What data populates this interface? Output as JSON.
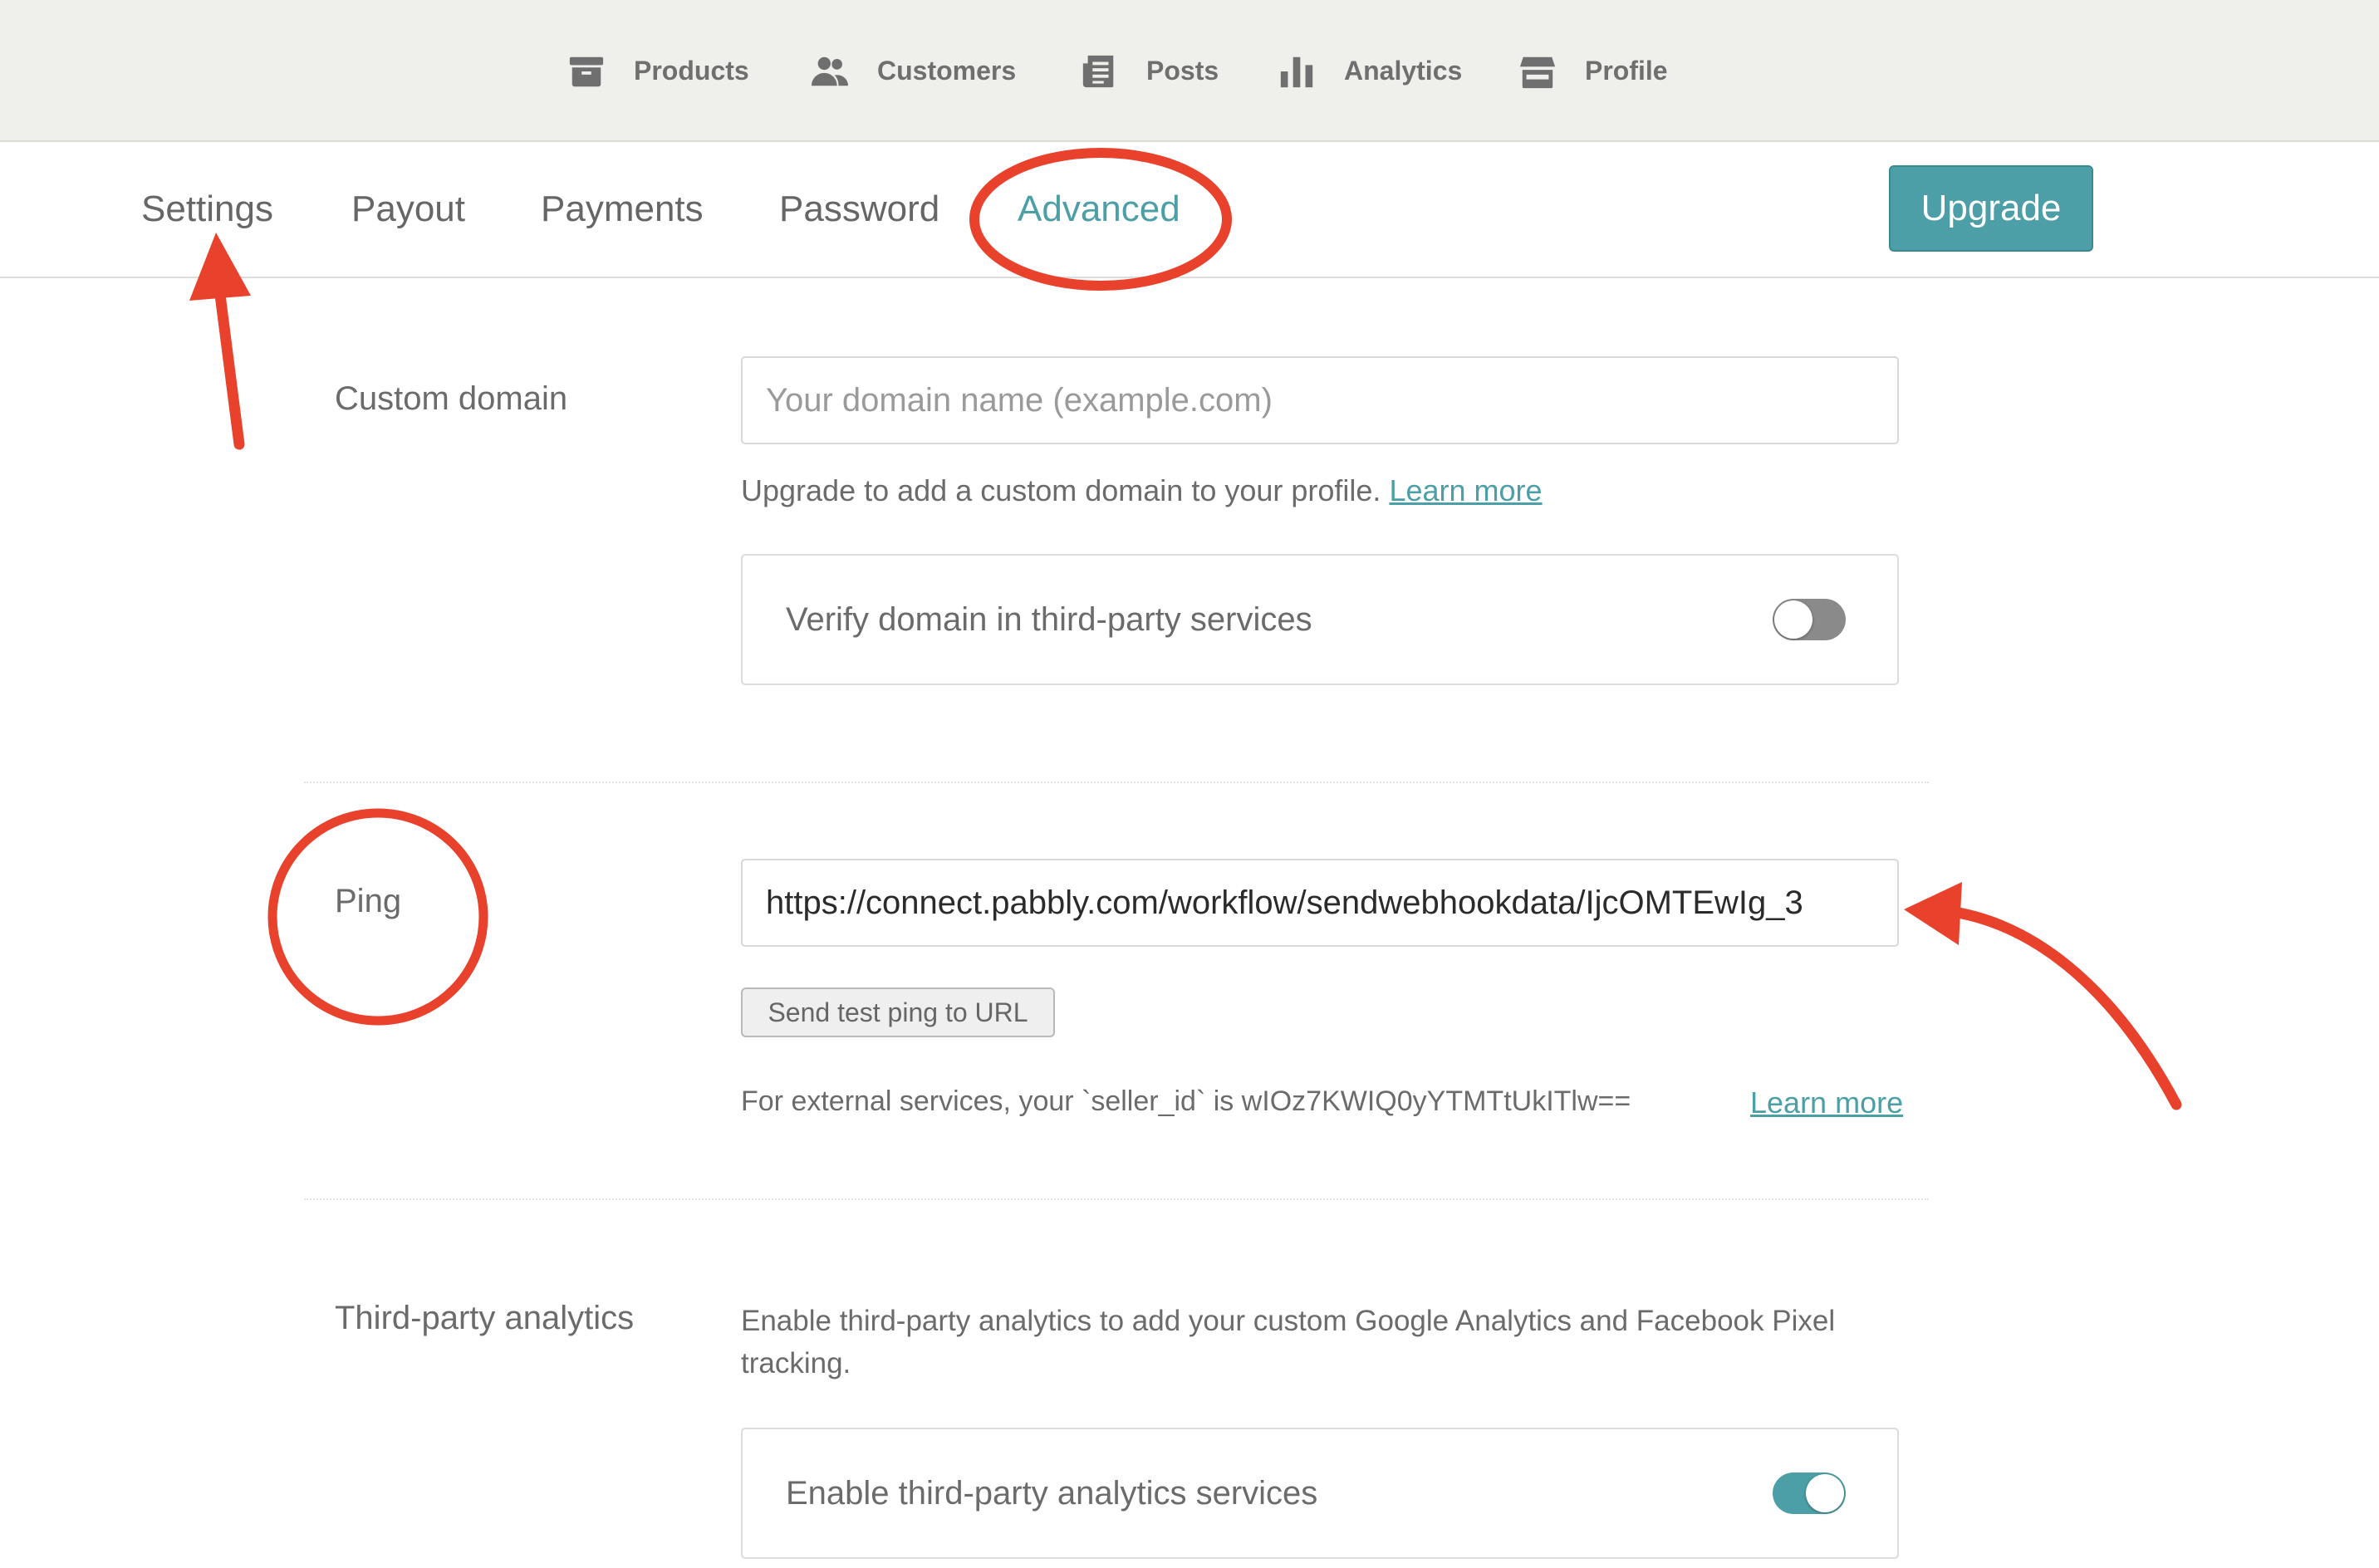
{
  "topnav": {
    "items": [
      {
        "label": "Products",
        "icon": "archive-box-icon"
      },
      {
        "label": "Customers",
        "icon": "users-icon"
      },
      {
        "label": "Posts",
        "icon": "document-list-icon"
      },
      {
        "label": "Analytics",
        "icon": "bar-chart-icon"
      },
      {
        "label": "Profile",
        "icon": "storefront-icon"
      }
    ]
  },
  "subnav": {
    "tabs": [
      {
        "label": "Settings"
      },
      {
        "label": "Payout"
      },
      {
        "label": "Payments"
      },
      {
        "label": "Password"
      },
      {
        "label": "Advanced",
        "active": true
      }
    ],
    "upgrade_label": "Upgrade"
  },
  "custom_domain": {
    "label": "Custom domain",
    "placeholder": "Your domain name (example.com)",
    "helper_text": "Upgrade to add a custom domain to your profile.",
    "learn_more": "Learn more",
    "verify_label": "Verify domain in third-party services",
    "verify_enabled": false
  },
  "ping": {
    "label": "Ping",
    "url_value": "https://connect.pabbly.com/workflow/sendwebhookdata/IjcOMTEwIg_3",
    "test_button": "Send test ping to URL",
    "seller_text": "For external services, your `seller_id` is wIOz7KWIQ0yYTMTtUkITlw==",
    "learn_more": "Learn more"
  },
  "analytics": {
    "label": "Third-party analytics",
    "description_line1": "Enable third-party analytics to add your custom Google Analytics and Facebook Pixel",
    "description_line2": "tracking.",
    "toggle_label": "Enable third-party analytics services",
    "toggle_enabled": true
  },
  "colors": {
    "accent": "#4c9fa6",
    "annotation": "#e8412c",
    "nav_bg": "#efefec"
  }
}
